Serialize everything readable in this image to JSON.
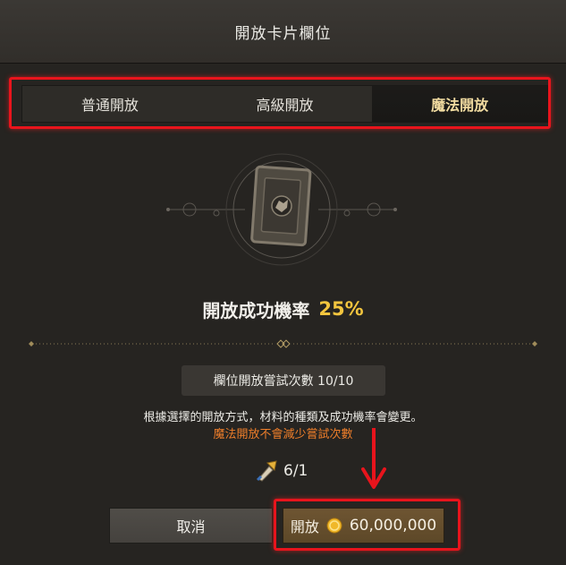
{
  "header": {
    "title": "開放卡片欄位"
  },
  "tabs": [
    {
      "label": "普通開放",
      "active": false
    },
    {
      "label": "高級開放",
      "active": false
    },
    {
      "label": "魔法開放",
      "active": true
    }
  ],
  "rate": {
    "label": "開放成功機率",
    "value": "25%"
  },
  "attempts": {
    "text": "欄位開放嘗試次數 10/10"
  },
  "notes": {
    "line1": "根據選擇的開放方式，材料的種類及成功機率會變更。",
    "line2": "魔法開放不會減少嘗試次數"
  },
  "material": {
    "icon": "scroll-quill-icon",
    "count": "6/1"
  },
  "buttons": {
    "cancel_label": "取消",
    "open_label": "開放",
    "open_price": "60,000,000",
    "currency_icon": "gold-coin-icon"
  },
  "colors": {
    "highlight": "#e8141c",
    "rate_value": "#f3c53e",
    "note_orange": "#ee7e2a",
    "active_tab_text": "#f2dca1"
  }
}
